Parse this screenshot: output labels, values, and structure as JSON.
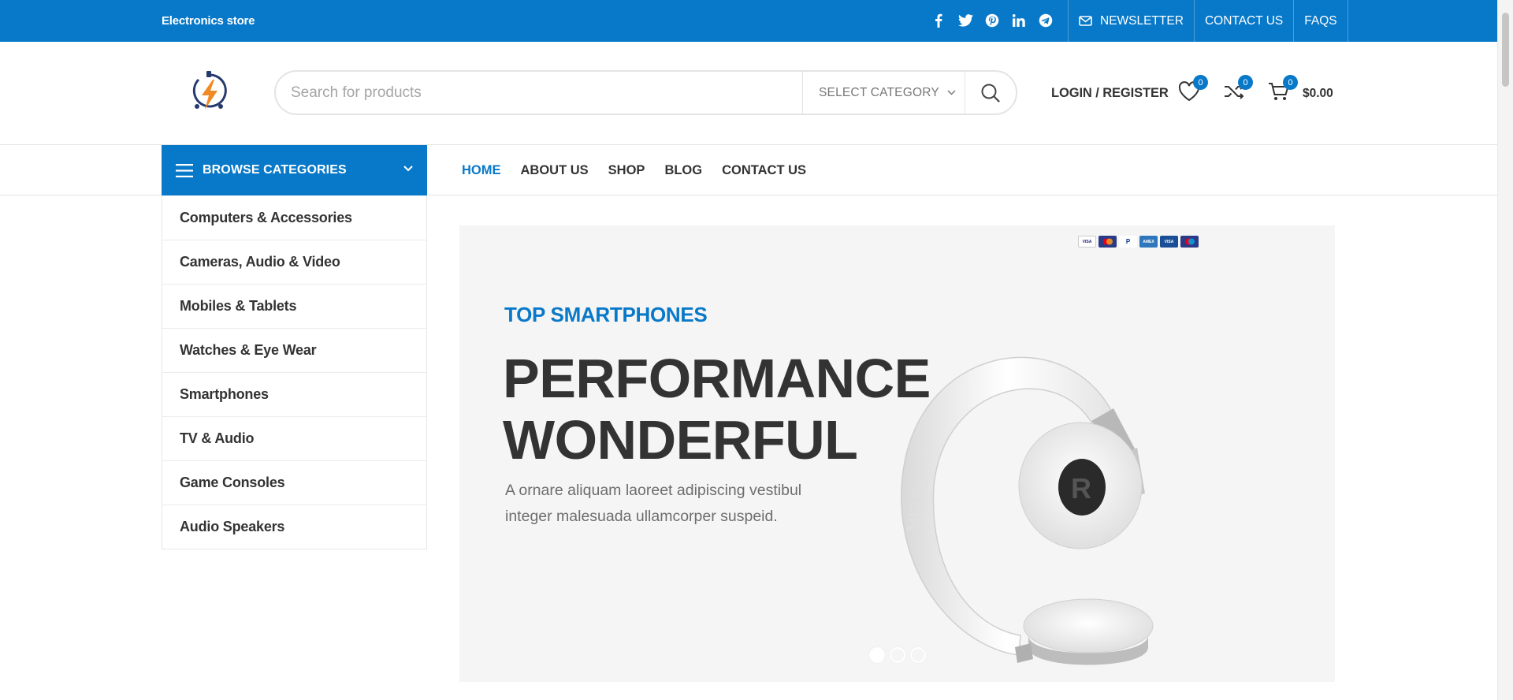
{
  "topbar": {
    "store_name": "Electronics store",
    "social_icons": [
      "facebook-icon",
      "twitter-icon",
      "pinterest-icon",
      "linkedin-icon",
      "telegram-icon"
    ],
    "links": {
      "newsletter": "NEWSLETTER",
      "contact": "CONTACT US",
      "faqs": "FAQS"
    }
  },
  "header": {
    "search_placeholder": "Search for products",
    "category_select": "SELECT CATEGORY",
    "account": "LOGIN / REGISTER",
    "wishlist_count": "0",
    "compare_count": "0",
    "cart_count": "0",
    "cart_total": "$0.00"
  },
  "nav": {
    "browse": "BROWSE CATEGORIES",
    "items": [
      "HOME",
      "ABOUT US",
      "SHOP",
      "BLOG",
      "CONTACT US"
    ]
  },
  "categories": [
    "Computers & Accessories",
    "Cameras, Audio & Video",
    "Mobiles & Tablets",
    "Watches & Eye Wear",
    "Smartphones",
    "TV & Audio",
    "Game Consoles",
    "Audio Speakers"
  ],
  "hero": {
    "kicker": "TOP SMARTPHONES",
    "headline_1": "PERFORMANCE",
    "headline_2": "WONDERFUL",
    "description": "A ornare aliquam laoreet adipiscing vestibul integer malesuada ullamcorper suspeid.",
    "slide_count": 3,
    "active_slide": 1
  },
  "colors": {
    "brand": "#0879c9",
    "text": "#333333",
    "muted": "#6d6d6d"
  }
}
